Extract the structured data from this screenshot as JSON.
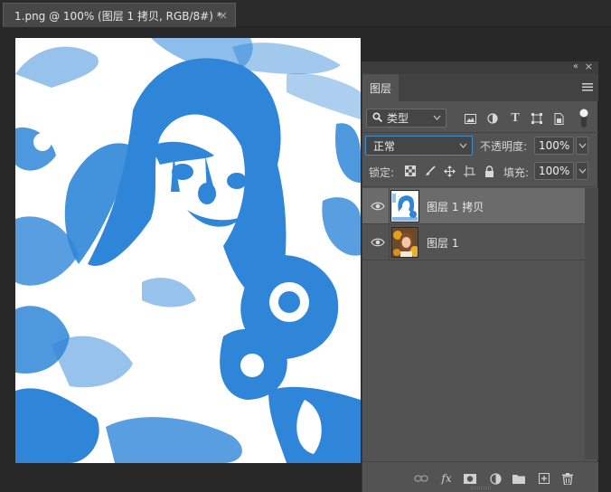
{
  "document_tab": {
    "title": "1.png @ 100% (图层 1 拷贝, RGB/8#) *",
    "close_glyph": "×"
  },
  "panel": {
    "collapse_glyph": "«",
    "close_glyph": "×",
    "tab_label": "图层",
    "menu_icon": "hamburger-menu-icon",
    "filter": {
      "icon": "search-icon",
      "label": "类型",
      "icons": [
        "image-filter-icon",
        "adjustment-filter-icon",
        "type-filter-icon",
        "shape-filter-icon",
        "smart-object-filter-icon"
      ],
      "type_glyph": "T"
    },
    "blend_mode": "正常",
    "opacity_label": "不透明度:",
    "opacity_value": "100%",
    "lock_label": "锁定:",
    "lock_icons": [
      "lock-transparent-icon",
      "lock-image-icon",
      "lock-position-icon",
      "lock-artboard-icon",
      "lock-all-icon"
    ],
    "fill_label": "填充:",
    "fill_value": "100%",
    "layers": [
      {
        "name": "图层 1 拷贝",
        "visible": true,
        "selected": true
      },
      {
        "name": "图层 1",
        "visible": true,
        "selected": false
      }
    ],
    "bottom_icons": [
      "link-layers-icon",
      "fx-icon",
      "add-mask-icon",
      "new-fill-adjustment-icon",
      "new-group-icon",
      "new-layer-icon",
      "delete-layer-icon"
    ],
    "fx_glyph": "fx"
  },
  "colors": {
    "artwork_blue": "#2f86d8",
    "selection_border": "#3e8ed0"
  }
}
